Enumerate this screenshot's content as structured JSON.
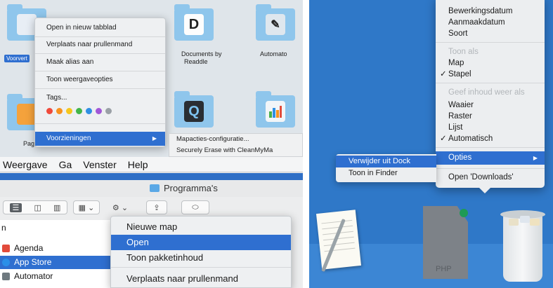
{
  "panel1": {
    "folders": [
      {
        "name": "Voorvertoning",
        "selected": true
      },
      {
        "name": "Documents by Readdle",
        "line1": "Documents by",
        "line2": "Readdle"
      },
      {
        "name": "Automator",
        "truncated": "Automato"
      },
      {
        "name": "Pages",
        "truncated": "Pag"
      }
    ],
    "selected_label": "Voorvert",
    "menu": {
      "items": [
        "Open in nieuw tabblad",
        "Verplaats naar prullenmand",
        "Maak alias aan",
        "Toon weergaveopties",
        "Tags..."
      ],
      "tag_colors": [
        "#f04a3b",
        "#f7931e",
        "#f5c61d",
        "#42b649",
        "#2f8fe3",
        "#a157d7",
        "#9aa0a6"
      ],
      "services": "Voorzieningen",
      "services_arrow": "▶"
    },
    "services_submenu": [
      "Mapacties-configuratie...",
      "Securely Erase with CleanMyMa"
    ]
  },
  "panel2": {
    "menubar": [
      "Weergave",
      "Ga",
      "Venster",
      "Help"
    ],
    "window_title": "Programma's",
    "toolbar": {
      "view_icons": "☰ ◫ ▥",
      "group": "▦ ⌄",
      "action": "⚙ ⌄",
      "share": "⇪",
      "tag": "⬭"
    },
    "list_header": "n",
    "files": [
      {
        "name": "Agenda",
        "color": "#e24b3b",
        "selected": false
      },
      {
        "name": "App Store",
        "color": "#2b8fe8",
        "selected": true
      },
      {
        "name": "Automator",
        "color": "#6f7a80",
        "selected": false
      }
    ],
    "menu": [
      "Nieuwe map",
      "Open",
      "Toon pakketinhoud",
      "Verplaats naar prullenmand"
    ]
  },
  "panel3": {
    "dock_menu": {
      "sort_items": [
        "Bewerkingsdatum",
        "Aanmaakdatum",
        "Soort"
      ],
      "display_as_header": "Toon als",
      "display_as": [
        "Map",
        "Stapel"
      ],
      "display_as_checked": "Stapel",
      "content_header": "Geef inhoud weer als",
      "content_as": [
        "Waaier",
        "Raster",
        "Lijst",
        "Automatisch"
      ],
      "content_as_checked": "Automatisch",
      "options": "Opties",
      "options_arrow": "▶",
      "open_downloads": "Open 'Downloads'",
      "check": "✓"
    },
    "options_submenu": [
      "Verwijder uit Dock",
      "Toon in Finder"
    ],
    "php_label": "PHP"
  }
}
